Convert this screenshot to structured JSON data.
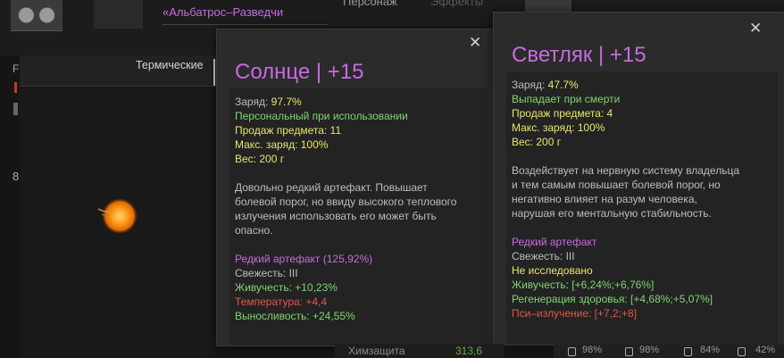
{
  "header": {
    "character_name": "«Альбатрос–Разведчи",
    "tab_person": "Персонаж",
    "tab_effects": "Эффекты"
  },
  "left_panel": {
    "category": "Термические",
    "side_letters": "F",
    "side_number": "8"
  },
  "tooltip_sun": {
    "title": "Солнце | +15",
    "charge_label": "Заряд:",
    "charge_value": "97.7%",
    "personal": "Персональный при использовании",
    "sale": "Продаж предмета: 11",
    "max_charge": "Макс. заряд: 100%",
    "weight": "Вес: 200 г",
    "desc": [
      "Довольно редкий артефакт. Повышает",
      "болевой порог, но ввиду высокого теплового",
      "излучения использовать его может быть",
      "опасно."
    ],
    "rarity": "Редкий артефакт (125,92%)",
    "freshness": "Свежесть: III",
    "stats": [
      {
        "text": "Живучесть: +10,23%",
        "color": "green"
      },
      {
        "text": "Температура: +4,4",
        "color": "red"
      },
      {
        "text": "Выносливость: +24,55%",
        "color": "green"
      }
    ]
  },
  "tooltip_firefly": {
    "title": "Светляк | +15",
    "charge_label": "Заряд:",
    "charge_value": "47.7%",
    "drop": "Выпадает при смерти",
    "sale": "Продаж предмета: 4",
    "max_charge": "Макс. заряд: 100%",
    "weight": "Вес: 200 г",
    "desc": [
      "Воздействует на нервную систему владельца",
      "и тем самым повышает болевой порог, но",
      "негативно влияет на разум человека,",
      "нарушая его ментальную стабильность."
    ],
    "rarity": "Редкий артефакт",
    "freshness": "Свежесть: III",
    "not_researched": "Не исследовано",
    "stats": [
      {
        "text": "Живучесть: [+6,24%;+6,76%]",
        "color": "green"
      },
      {
        "text": "Регенерация здоровья: [+4,68%;+5,07%]",
        "color": "green"
      },
      {
        "text": "Пси–излучение: [+7,2;+8]",
        "color": "red"
      }
    ]
  },
  "bottom": {
    "label": "Химзащита",
    "value": "313,6",
    "slots": [
      "98%",
      "98%",
      "84%",
      "42%"
    ]
  },
  "colors": {
    "title_purple": "#c86be0",
    "value_yellow": "#e8e56a",
    "positive_green": "#7fd66f",
    "negative_red": "#e0554e"
  },
  "icons": {
    "close": "close-icon",
    "artifact": "artifact-icon",
    "lock": "lock-icon"
  }
}
